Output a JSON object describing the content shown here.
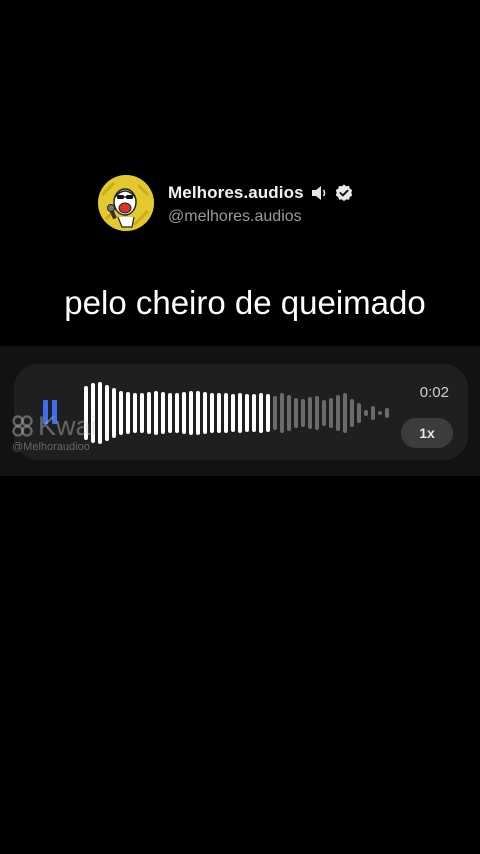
{
  "profile": {
    "display_name": "Melhores.audios",
    "handle": "@melhores.audios",
    "avatar_icon": "cartoon-singer-avatar",
    "speaker_icon": "speaker-volume-icon",
    "verified_icon": "verified-badge-icon"
  },
  "caption": "pelo cheiro de queimado",
  "player": {
    "play_state_icon": "pause-icon",
    "elapsed_time": "0:02",
    "speed_label": "1x",
    "progress": 0.62,
    "waveform_icon": "audio-waveform",
    "colors": {
      "played": "#ffffff",
      "unplayed": "#6b6b6b",
      "pause": "#3f6ff0",
      "panel": "#1d1f20"
    }
  },
  "watermark": {
    "brand": "Kwai",
    "user": "@Melhoraudioo",
    "logo_icon": "kwai-logo-icon"
  }
}
